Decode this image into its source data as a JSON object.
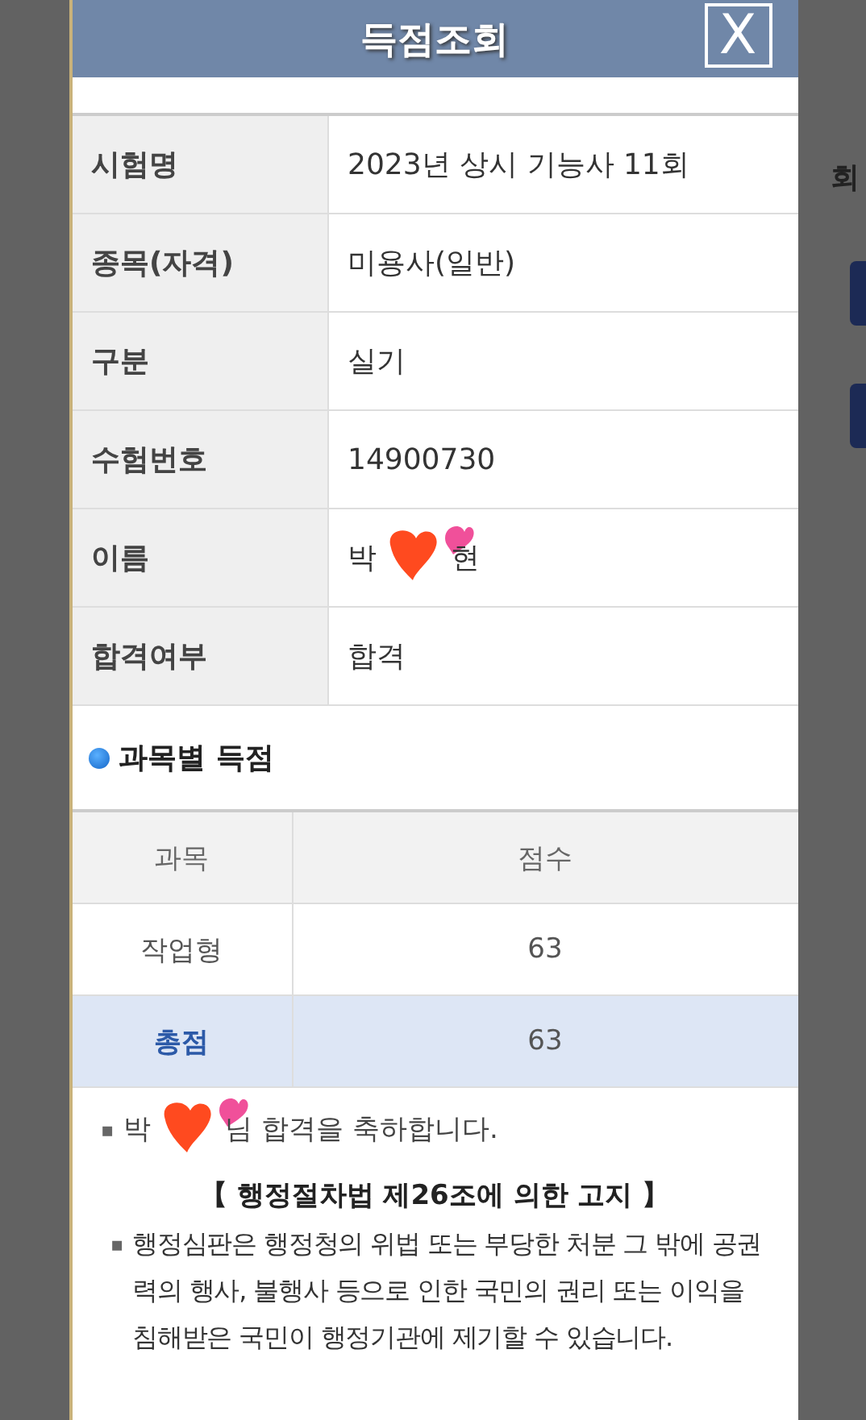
{
  "modal": {
    "title": "득점조회",
    "close_label": "X"
  },
  "background": {
    "column_label": "회"
  },
  "applicant": [
    {
      "label": "시험명",
      "value": "2023년 상시 기능사 11회"
    },
    {
      "label": "종목(자격)",
      "value": "미용사(일반)"
    },
    {
      "label": "구분",
      "value": "실기"
    },
    {
      "label": "수험번호",
      "value": "14900730"
    },
    {
      "label": "이름",
      "value": "박",
      "value_end": "현",
      "kind": "hidden"
    },
    {
      "label": "합격여부",
      "value": "합격"
    }
  ],
  "scores": {
    "heading": "과목별 득점",
    "columns": [
      "과목",
      "점수"
    ],
    "rows": [
      {
        "subject": "작업형",
        "score": "63",
        "kind": "subject"
      },
      {
        "subject": "총점",
        "score": "63",
        "kind": "total"
      }
    ]
  },
  "message": {
    "bullet": "▪",
    "start": "박",
    "end": "님 합격을 축하합니다."
  },
  "notice": {
    "title": "【 행정절차법 제26조에 의한 고지 】",
    "bullet": "▪",
    "text": "행정심판은 행정청의 위법 또는 부당한 처분 그 밖에 공권력의 행사, 불행사 등으로 인한 국민의 권리 또는 이익을 침해받은 국민이 행정기관에 제기할 수 있습니다."
  }
}
